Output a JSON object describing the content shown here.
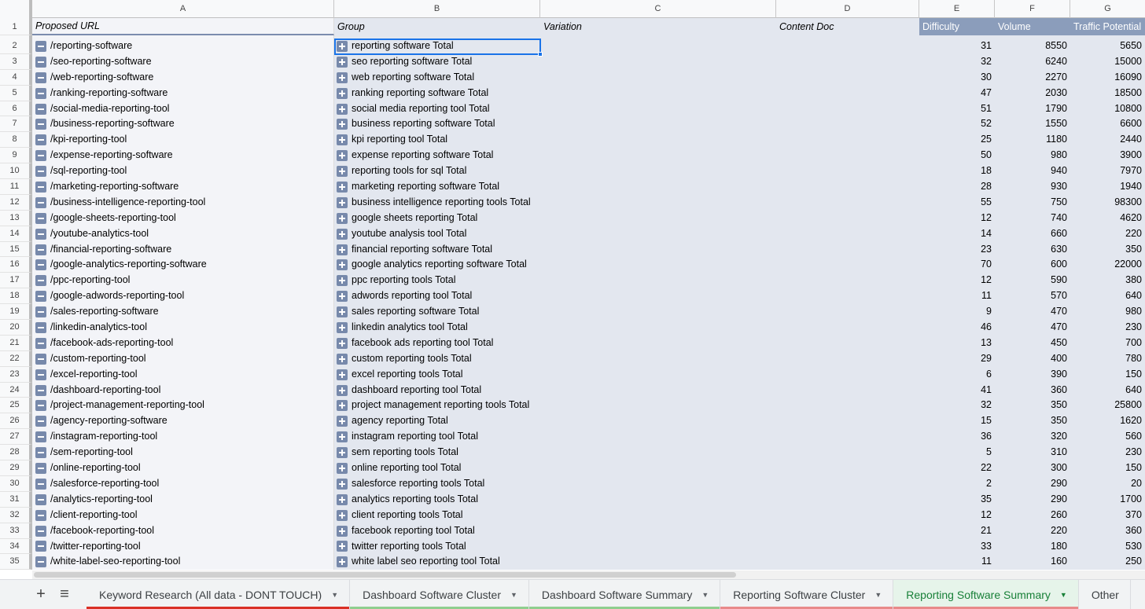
{
  "columns": [
    "A",
    "B",
    "C",
    "D",
    "E",
    "F",
    "G"
  ],
  "header": {
    "row_number": "1",
    "proposed_url": "Proposed URL",
    "group": "Group",
    "variation": "Variation",
    "content_doc": "Content Doc",
    "difficulty": "Difficulty",
    "volume": "Volume",
    "traffic_potential": "Traffic Potential"
  },
  "rows": [
    {
      "n": "2",
      "url": "/reporting-software",
      "group": "reporting software Total",
      "difficulty": "31",
      "volume": "8550",
      "traffic": "5650"
    },
    {
      "n": "3",
      "url": "/seo-reporting-software",
      "group": "seo reporting software Total",
      "difficulty": "32",
      "volume": "6240",
      "traffic": "15000"
    },
    {
      "n": "4",
      "url": "/web-reporting-software",
      "group": "web reporting software Total",
      "difficulty": "30",
      "volume": "2270",
      "traffic": "16090"
    },
    {
      "n": "5",
      "url": "/ranking-reporting-software",
      "group": "ranking reporting software Total",
      "difficulty": "47",
      "volume": "2030",
      "traffic": "18500"
    },
    {
      "n": "6",
      "url": "/social-media-reporting-tool",
      "group": "social media reporting tool Total",
      "difficulty": "51",
      "volume": "1790",
      "traffic": "10800"
    },
    {
      "n": "7",
      "url": "/business-reporting-software",
      "group": "business reporting software Total",
      "difficulty": "52",
      "volume": "1550",
      "traffic": "6600"
    },
    {
      "n": "8",
      "url": "/kpi-reporting-tool",
      "group": "kpi reporting tool Total",
      "difficulty": "25",
      "volume": "1180",
      "traffic": "2440"
    },
    {
      "n": "9",
      "url": "/expense-reporting-software",
      "group": "expense reporting software Total",
      "difficulty": "50",
      "volume": "980",
      "traffic": "3900"
    },
    {
      "n": "10",
      "url": "/sql-reporting-tool",
      "group": "reporting tools for sql Total",
      "difficulty": "18",
      "volume": "940",
      "traffic": "7970"
    },
    {
      "n": "11",
      "url": "/marketing-reporting-software",
      "group": "marketing reporting software Total",
      "difficulty": "28",
      "volume": "930",
      "traffic": "1940"
    },
    {
      "n": "12",
      "url": "/business-intelligence-reporting-tool",
      "group": "business intelligence reporting tools Total",
      "difficulty": "55",
      "volume": "750",
      "traffic": "98300"
    },
    {
      "n": "13",
      "url": "/google-sheets-reporting-tool",
      "group": "google sheets reporting Total",
      "difficulty": "12",
      "volume": "740",
      "traffic": "4620"
    },
    {
      "n": "14",
      "url": "/youtube-analytics-tool",
      "group": "youtube analysis tool Total",
      "difficulty": "14",
      "volume": "660",
      "traffic": "220"
    },
    {
      "n": "15",
      "url": "/financial-reporting-software",
      "group": "financial reporting software Total",
      "difficulty": "23",
      "volume": "630",
      "traffic": "350"
    },
    {
      "n": "16",
      "url": "/google-analytics-reporting-software",
      "group": "google analytics reporting software Total",
      "difficulty": "70",
      "volume": "600",
      "traffic": "22000"
    },
    {
      "n": "17",
      "url": "/ppc-reporting-tool",
      "group": "ppc reporting tools Total",
      "difficulty": "12",
      "volume": "590",
      "traffic": "380"
    },
    {
      "n": "18",
      "url": "/google-adwords-reporting-tool",
      "group": "adwords reporting tool Total",
      "difficulty": "11",
      "volume": "570",
      "traffic": "640"
    },
    {
      "n": "19",
      "url": "/sales-reporting-software",
      "group": "sales reporting software Total",
      "difficulty": "9",
      "volume": "470",
      "traffic": "980"
    },
    {
      "n": "20",
      "url": "/linkedin-analytics-tool",
      "group": "linkedin analytics tool Total",
      "difficulty": "46",
      "volume": "470",
      "traffic": "230"
    },
    {
      "n": "21",
      "url": "/facebook-ads-reporting-tool",
      "group": "facebook ads reporting tool Total",
      "difficulty": "13",
      "volume": "450",
      "traffic": "700"
    },
    {
      "n": "22",
      "url": "/custom-reporting-tool",
      "group": "custom reporting tools Total",
      "difficulty": "29",
      "volume": "400",
      "traffic": "780"
    },
    {
      "n": "23",
      "url": "/excel-reporting-tool",
      "group": "excel reporting tools Total",
      "difficulty": "6",
      "volume": "390",
      "traffic": "150"
    },
    {
      "n": "24",
      "url": "/dashboard-reporting-tool",
      "group": "dashboard reporting tool Total",
      "difficulty": "41",
      "volume": "360",
      "traffic": "640"
    },
    {
      "n": "25",
      "url": "/project-management-reporting-tool",
      "group": "project management reporting tools Total",
      "difficulty": "32",
      "volume": "350",
      "traffic": "25800"
    },
    {
      "n": "26",
      "url": "/agency-reporting-software",
      "group": "agency reporting Total",
      "difficulty": "15",
      "volume": "350",
      "traffic": "1620"
    },
    {
      "n": "27",
      "url": "/instagram-reporting-tool",
      "group": "instagram reporting tool Total",
      "difficulty": "36",
      "volume": "320",
      "traffic": "560"
    },
    {
      "n": "28",
      "url": "/sem-reporting-tool",
      "group": "sem reporting tools Total",
      "difficulty": "5",
      "volume": "310",
      "traffic": "230"
    },
    {
      "n": "29",
      "url": "/online-reporting-tool",
      "group": "online reporting tool Total",
      "difficulty": "22",
      "volume": "300",
      "traffic": "150"
    },
    {
      "n": "30",
      "url": "/salesforce-reporting-tool",
      "group": "salesforce reporting tools Total",
      "difficulty": "2",
      "volume": "290",
      "traffic": "20"
    },
    {
      "n": "31",
      "url": "/analytics-reporting-tool",
      "group": "analytics reporting tools Total",
      "difficulty": "35",
      "volume": "290",
      "traffic": "1700"
    },
    {
      "n": "32",
      "url": "/client-reporting-tool",
      "group": "client reporting tools Total",
      "difficulty": "12",
      "volume": "260",
      "traffic": "370"
    },
    {
      "n": "33",
      "url": "/facebook-reporting-tool",
      "group": "facebook reporting tool Total",
      "difficulty": "21",
      "volume": "220",
      "traffic": "360"
    },
    {
      "n": "34",
      "url": "/twitter-reporting-tool",
      "group": "twitter reporting tools Total",
      "difficulty": "33",
      "volume": "180",
      "traffic": "530"
    },
    {
      "n": "35",
      "url": "/white-label-seo-reporting-tool",
      "group": "white label seo reporting tool Total",
      "difficulty": "11",
      "volume": "160",
      "traffic": "250"
    }
  ],
  "tabs": [
    {
      "label": "Keyword Research (All data - DONT TOUCH)",
      "color": "#d93025",
      "active": false
    },
    {
      "label": "Dashboard Software Cluster",
      "color": "#8fce8f",
      "active": false
    },
    {
      "label": "Dashboard Software Summary",
      "color": "#8fce8f",
      "active": false
    },
    {
      "label": "Reporting Software Cluster",
      "color": "#e88a8a",
      "active": false
    },
    {
      "label": "Reporting Software Summary",
      "color": "#e88a8a",
      "active": true
    },
    {
      "label": "Other",
      "color": "",
      "active": false
    }
  ],
  "icons": {
    "add_sheet": "+",
    "all_sheets": "≡",
    "row_group_toggle": "minus-icon",
    "cell_group_toggle": "plus-icon",
    "tab_menu": "▼"
  },
  "colors": {
    "selection": "#1a73e8",
    "header_numeric_bg": "#8b9dbb",
    "group_button": "#7789ab",
    "active_tab_text": "#188038"
  }
}
